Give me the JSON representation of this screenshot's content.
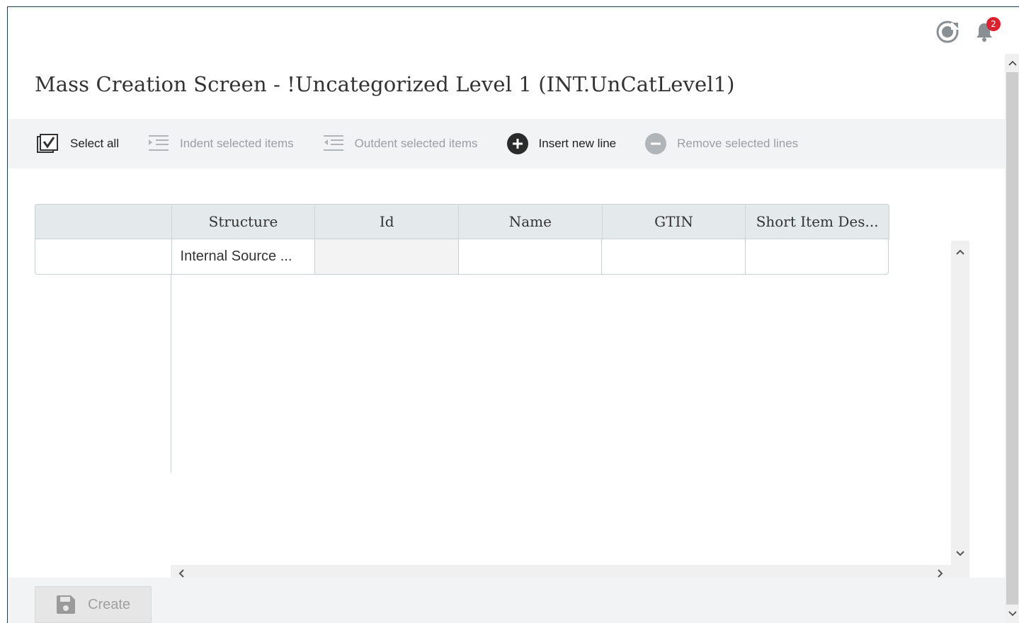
{
  "header": {
    "history_icon": "history-icon",
    "notifications_icon": "bell-icon",
    "notification_count": "2",
    "badge_color": "#d9232e"
  },
  "page": {
    "title": "Mass Creation Screen - !Uncategorized Level 1 (INT.UnCatLevel1)"
  },
  "toolbar": {
    "select_all": "Select all",
    "indent": "Indent selected items",
    "outdent": "Outdent selected items",
    "insert": "Insert new line",
    "remove": "Remove selected lines"
  },
  "grid": {
    "columns": [
      "Structure",
      "Id",
      "Name",
      "GTIN",
      "Short Item Des..."
    ],
    "rows": [
      [
        "Internal Source ...",
        "",
        "",
        "",
        ""
      ]
    ]
  },
  "footer": {
    "create_label": "Create"
  }
}
